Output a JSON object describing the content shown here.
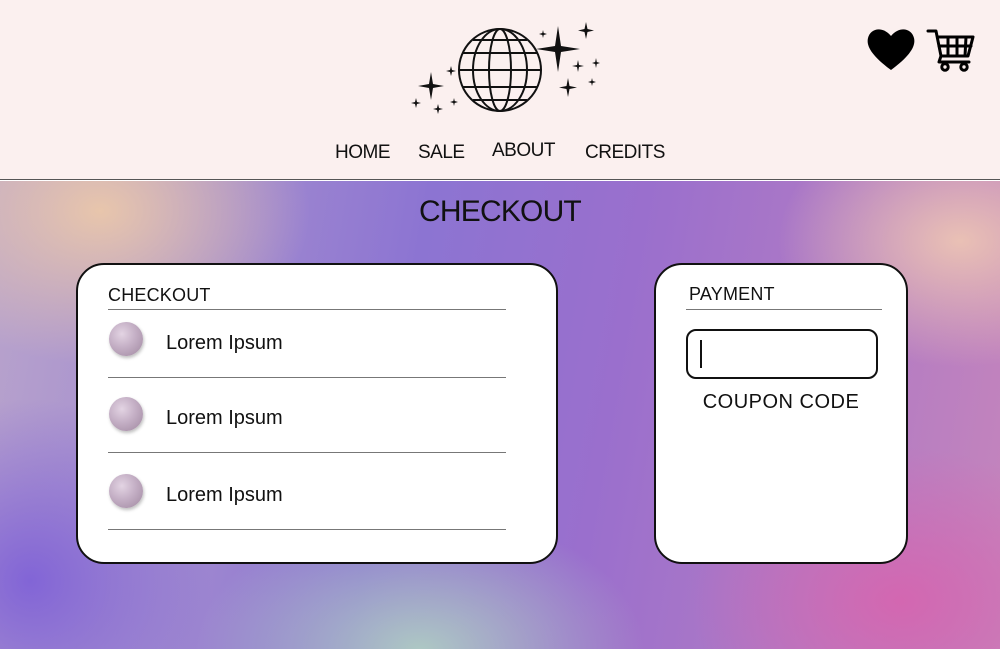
{
  "header": {
    "logo": "disco-globe-logo",
    "nav": [
      {
        "label": "HOME"
      },
      {
        "label": "SALE"
      },
      {
        "label": "ABOUT"
      },
      {
        "label": "CREDITS"
      }
    ],
    "icons": {
      "wishlist": "heart-icon",
      "cart": "shopping-cart-icon"
    }
  },
  "main": {
    "title": "CHECKOUT",
    "checkout": {
      "heading": "CHECKOUT",
      "items": [
        {
          "label": "Lorem Ipsum"
        },
        {
          "label": "Lorem Ipsum"
        },
        {
          "label": "Lorem Ipsum"
        }
      ]
    },
    "payment": {
      "heading": "PAYMENT",
      "coupon_value": "",
      "coupon_label": "COUPON CODE"
    }
  },
  "colors": {
    "header_bg": "#fbf0ef",
    "panel_bg": "#ffffff",
    "gradient_purple": "#8c74d2",
    "gradient_pink": "#d664af",
    "gradient_peach": "#ebc8aa",
    "gradient_mint": "#afcdc3"
  }
}
